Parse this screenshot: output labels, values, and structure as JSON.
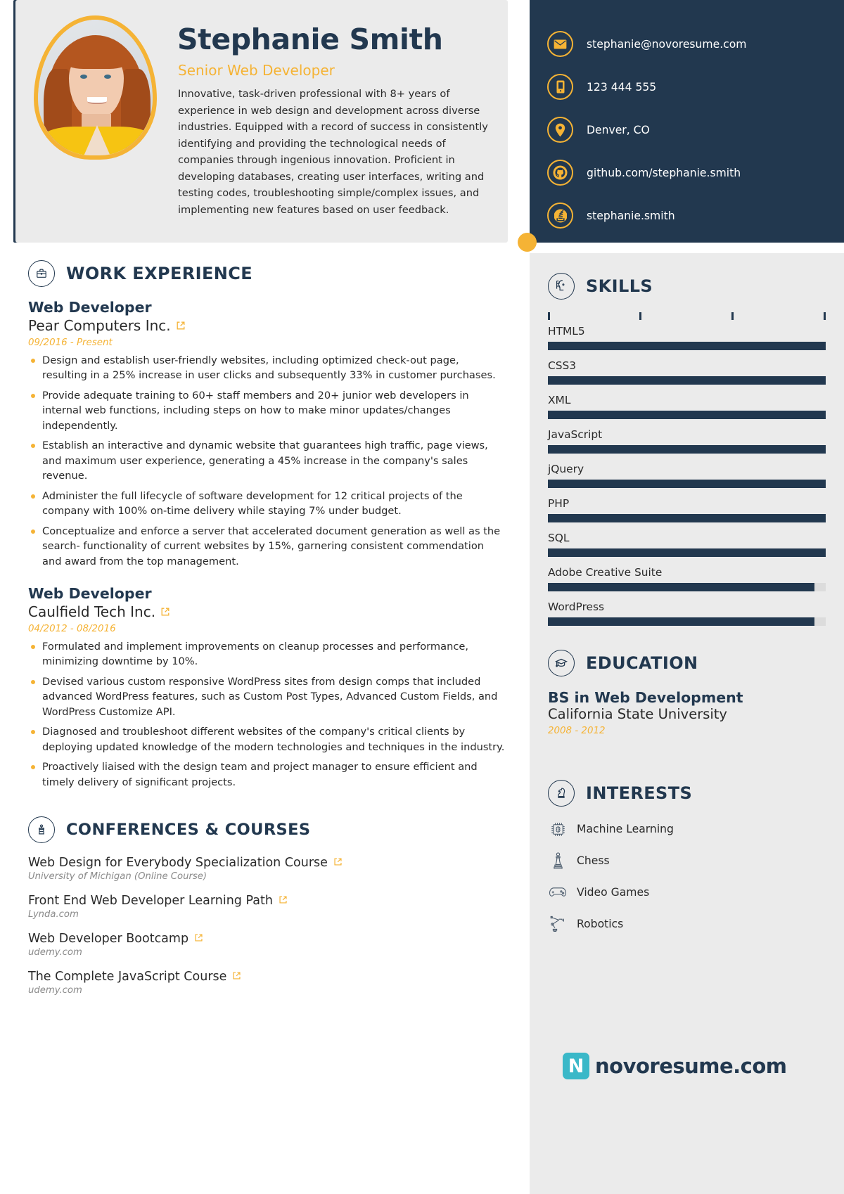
{
  "profile": {
    "name": "Stephanie Smith",
    "role": "Senior Web Developer",
    "summary": "Innovative, task-driven professional with 8+ years of experience in web design and development across diverse industries. Equipped with a record of success in consistently identifying and providing the technological needs of companies through ingenious innovation. Proficient in developing databases, creating user interfaces, writing and testing codes, troubleshooting simple/complex issues, and implementing new features based on user feedback.",
    "photo_alt": "profile-photo"
  },
  "contact": [
    {
      "icon": "mail-icon",
      "value": "stephanie@novoresume.com"
    },
    {
      "icon": "phone-icon",
      "value": "123 444 555"
    },
    {
      "icon": "location-pin-icon",
      "value": "Denver, CO"
    },
    {
      "icon": "github-icon",
      "value": "github.com/stephanie.smith"
    },
    {
      "icon": "stackoverflow-icon",
      "value": "stephanie.smith"
    }
  ],
  "sections": {
    "work": {
      "title": "WORK EXPERIENCE",
      "icon": "briefcase-icon"
    },
    "conferences": {
      "title": "CONFERENCES & COURSES",
      "icon": "podium-icon"
    },
    "skills": {
      "title": "SKILLS",
      "icon": "skills-head-gear-icon"
    },
    "education": {
      "title": "EDUCATION",
      "icon": "graduation-cap-icon"
    },
    "interests": {
      "title": "INTERESTS",
      "icon": "chess-knight-icon"
    }
  },
  "jobs": [
    {
      "title": "Web Developer",
      "company": "Pear Computers Inc.",
      "link_icon": "external-link-icon",
      "date": "09/2016 - Present",
      "bullets": [
        "Design and establish user-friendly websites, including optimized check-out page, resulting in a 25% increase in user clicks and subsequently 33% in customer purchases.",
        "Provide adequate training to 60+ staff members and 20+ junior web developers in internal web functions, including steps on how to make minor updates/changes independently.",
        "Establish an interactive and dynamic website that guarantees high traffic, page views, and maximum user experience, generating a 45% increase in the company's sales revenue.",
        "Administer the full lifecycle of software development for 12 critical projects of the company with 100% on-time delivery while staying 7% under budget.",
        "Conceptualize and enforce a server that accelerated document generation as well as the search- functionality of current websites by 15%, garnering consistent commendation and award from the top management."
      ]
    },
    {
      "title": "Web Developer",
      "company": "Caulfield Tech Inc.",
      "link_icon": "external-link-icon",
      "date": "04/2012 - 08/2016",
      "bullets": [
        "Formulated and implement improvements on cleanup processes and performance, minimizing downtime by 10%.",
        "Devised various custom responsive WordPress sites from design comps that included advanced WordPress features, such as Custom Post Types, Advanced Custom Fields, and WordPress Customize API.",
        "Diagnosed and troubleshoot different websites of the company's critical clients by deploying updated knowledge of the modern technologies and techniques in the industry.",
        "Proactively liaised with the design team and project manager to ensure efficient and timely delivery of significant projects."
      ]
    }
  ],
  "courses": [
    {
      "name": "Web Design for Everybody Specialization Course",
      "org": "University of Michigan (Online Course)",
      "link_icon": "external-link-icon"
    },
    {
      "name": "Front End Web Developer Learning Path",
      "org": "Lynda.com",
      "link_icon": "external-link-icon"
    },
    {
      "name": "Web Developer Bootcamp",
      "org": "udemy.com",
      "link_icon": "external-link-icon"
    },
    {
      "name": "The Complete JavaScript Course",
      "org": "udemy.com",
      "link_icon": "external-link-icon"
    }
  ],
  "skills": {
    "scale_ticks": [
      0,
      33,
      66,
      100
    ],
    "items": [
      {
        "name": "HTML5",
        "level": 100
      },
      {
        "name": "CSS3",
        "level": 100
      },
      {
        "name": "XML",
        "level": 100
      },
      {
        "name": "JavaScript",
        "level": 100
      },
      {
        "name": "jQuery",
        "level": 100
      },
      {
        "name": "PHP",
        "level": 100
      },
      {
        "name": "SQL",
        "level": 100
      },
      {
        "name": "Adobe Creative Suite",
        "level": 96
      },
      {
        "name": "WordPress",
        "level": 96
      }
    ]
  },
  "education": [
    {
      "degree": "BS in Web Development",
      "school": "California State University",
      "date": "2008 - 2012"
    }
  ],
  "interests": [
    {
      "icon": "cpu-brain-icon",
      "label": "Machine Learning"
    },
    {
      "icon": "chess-pawn-icon",
      "label": "Chess"
    },
    {
      "icon": "gamepad-icon",
      "label": "Video Games"
    },
    {
      "icon": "robot-arm-icon",
      "label": "Robotics"
    }
  ],
  "footer": {
    "logo_mark": "N",
    "logo_text": "novoresume.com"
  },
  "colors": {
    "dark": "#22384f",
    "accent": "#f5b335",
    "panel": "#ebebeb",
    "logo_teal": "#3ab8c8"
  }
}
